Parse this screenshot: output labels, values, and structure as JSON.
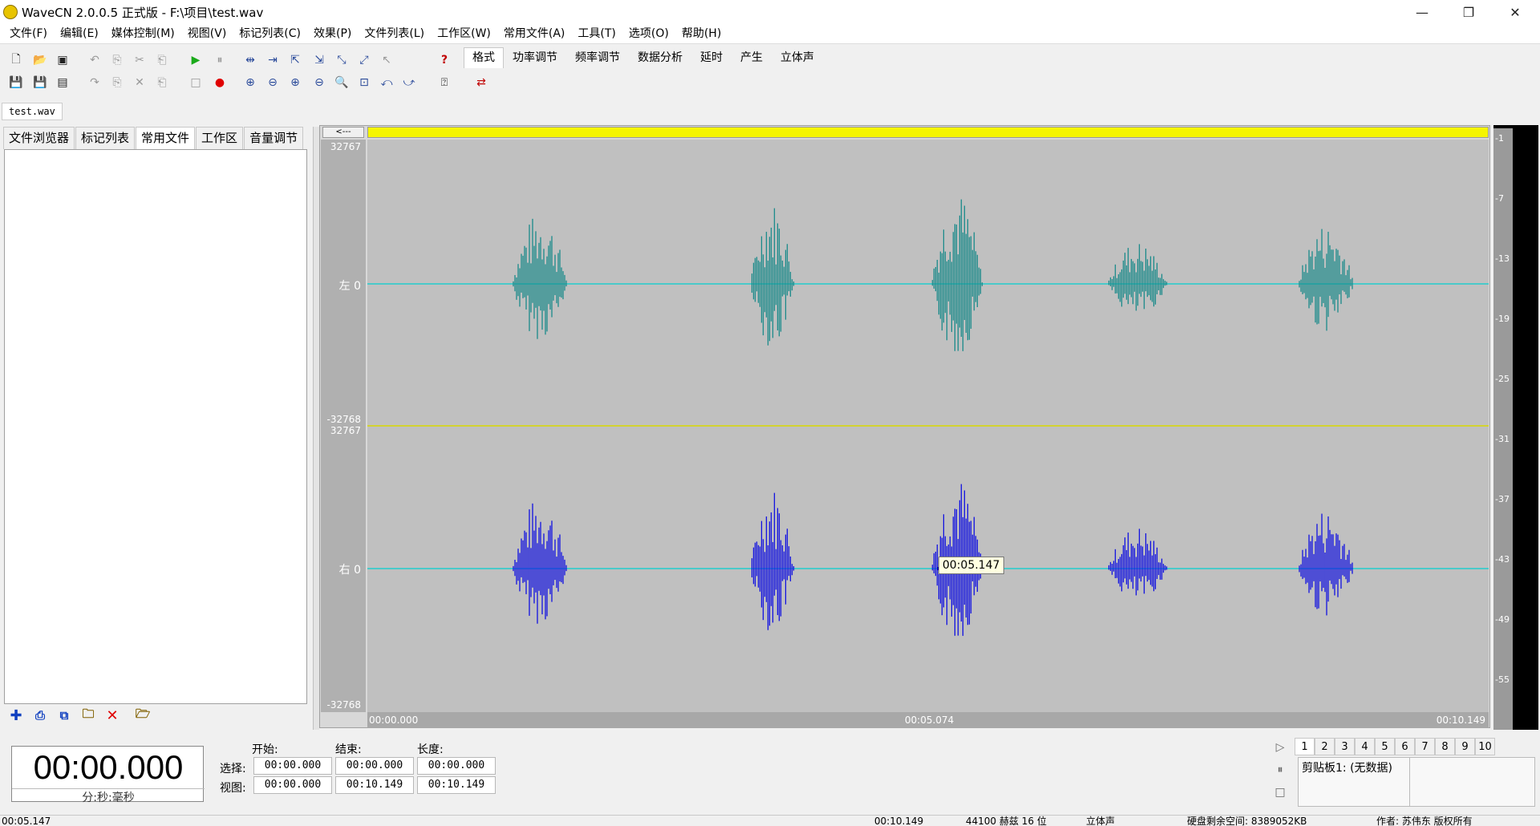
{
  "window": {
    "title": "WaveCN 2.0.0.5 正式版 - F:\\项目\\test.wav",
    "minimize": "—",
    "restore": "❐",
    "close": "✕"
  },
  "menu": [
    "文件(F)",
    "编辑(E)",
    "媒体控制(M)",
    "视图(V)",
    "标记列表(C)",
    "效果(P)",
    "文件列表(L)",
    "工作区(W)",
    "常用文件(A)",
    "工具(T)",
    "选项(O)",
    "帮助(H)"
  ],
  "function_tabs": [
    "格式",
    "功率调节",
    "频率调节",
    "数据分析",
    "延时",
    "产生",
    "立体声"
  ],
  "file_tab": "test.wav",
  "left_tabs": [
    "文件浏览器",
    "标记列表",
    "常用文件",
    "工作区",
    "音量调节"
  ],
  "left_active_tab": "常用文件",
  "wave": {
    "scroll_button": "<---",
    "y_labels": {
      "top_left": "32767",
      "zero_left": "左 0",
      "bottom_left": "-32768",
      "top_right": "32767",
      "zero_right": "右 0",
      "bottom_right": "-32768"
    },
    "x_labels": [
      "00:00.000",
      "00:05.074",
      "00:10.149"
    ],
    "tooltip": "00:05.147",
    "left_color": "#1a8a8a",
    "right_color": "#1010e0",
    "axis_color": "#22cccc"
  },
  "meter_labels": [
    "-1",
    "-7",
    "-13",
    "-19",
    "-25",
    "-31",
    "-37",
    "-43",
    "-49",
    "-55"
  ],
  "time": {
    "display": "00:00.000",
    "unit": "分:秒:毫秒"
  },
  "selection": {
    "headers": [
      "开始:",
      "结束:",
      "长度:"
    ],
    "rows": [
      {
        "label": "选择:",
        "start": "00:00.000",
        "end": "00:00.000",
        "length": "00:00.000"
      },
      {
        "label": "视图:",
        "start": "00:00.000",
        "end": "00:10.149",
        "length": "00:10.149"
      }
    ]
  },
  "clipboard_tabs": [
    "1",
    "2",
    "3",
    "4",
    "5",
    "6",
    "7",
    "8",
    "9",
    "10"
  ],
  "clipboard_text": "剪贴板1: (无数据)",
  "status": {
    "cursor": "00:05.147",
    "duration": "00:10.149",
    "format": "44100 赫兹  16 位",
    "channels": "立体声",
    "disk": "硬盘剩余空间: 8389052KB",
    "author": "作者: 苏伟东 版权所有"
  }
}
